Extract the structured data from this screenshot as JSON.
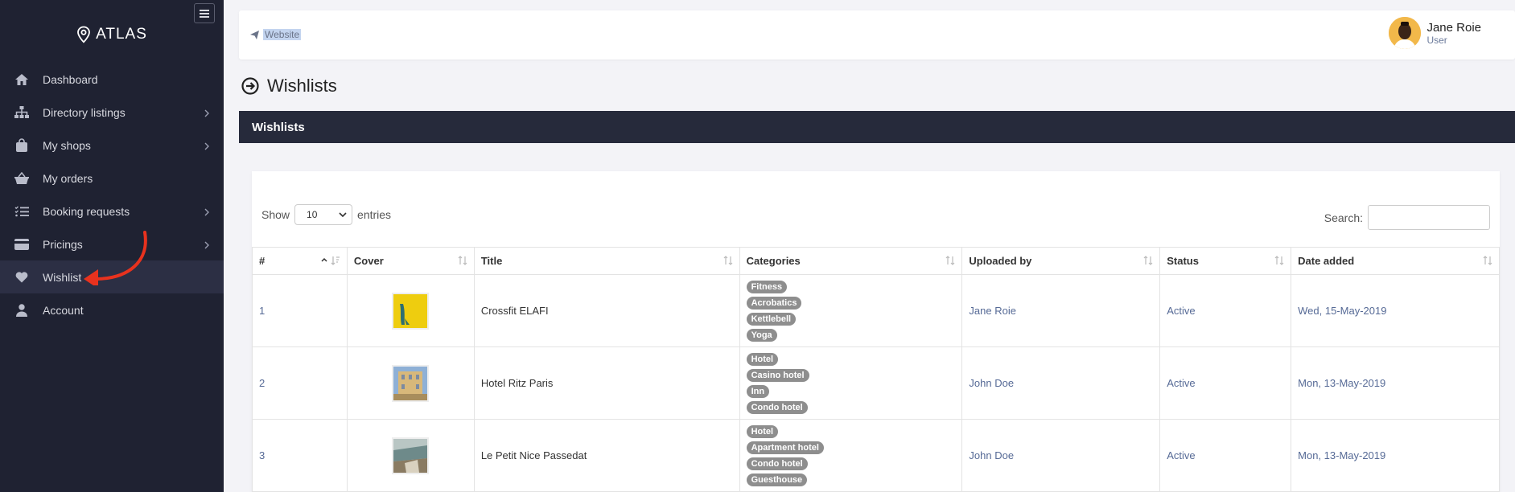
{
  "sidebar": {
    "brand": "ATLAS",
    "items": [
      {
        "label": "Dashboard",
        "icon": "home-icon",
        "chevron": false
      },
      {
        "label": "Directory listings",
        "icon": "sitemap-icon",
        "chevron": true
      },
      {
        "label": "My shops",
        "icon": "shopping-bag-icon",
        "chevron": true
      },
      {
        "label": "My orders",
        "icon": "basket-icon",
        "chevron": false
      },
      {
        "label": "Booking requests",
        "icon": "list-check-icon",
        "chevron": true
      },
      {
        "label": "Pricings",
        "icon": "credit-card-icon",
        "chevron": true
      },
      {
        "label": "Wishlist",
        "icon": "heart-icon",
        "chevron": false
      },
      {
        "label": "Account",
        "icon": "user-icon",
        "chevron": false
      }
    ]
  },
  "topbar": {
    "website_label": "Website",
    "user_name": "Jane Roie",
    "user_role": "User"
  },
  "page": {
    "title": "Wishlists"
  },
  "card": {
    "header": "Wishlists",
    "show_label": "Show",
    "entries_value": "10",
    "entries_label": "entries",
    "search_label": "Search:"
  },
  "table": {
    "columns": [
      "#",
      "Cover",
      "Title",
      "Categories",
      "Uploaded by",
      "Status",
      "Date added"
    ],
    "rows": [
      {
        "num": "1",
        "title": "Crossfit ELAFI",
        "categories": [
          "Fitness",
          "Acrobatics",
          "Kettlebell",
          "Yoga"
        ],
        "uploaded_by": "Jane Roie",
        "status": "Active",
        "date": "Wed, 15-May-2019"
      },
      {
        "num": "2",
        "title": "Hotel Ritz Paris",
        "categories": [
          "Hotel",
          "Casino hotel",
          "Inn",
          "Condo hotel"
        ],
        "uploaded_by": "John Doe",
        "status": "Active",
        "date": "Mon, 13-May-2019"
      },
      {
        "num": "3",
        "title": "Le Petit Nice Passedat",
        "categories": [
          "Hotel",
          "Apartment hotel",
          "Condo hotel",
          "Guesthouse"
        ],
        "uploaded_by": "John Doe",
        "status": "Active",
        "date": "Mon, 13-May-2019"
      }
    ]
  },
  "colors": {
    "sidebar_bg": "#1f2232",
    "card_header_bg": "#262a3b",
    "annotation_red": "#e8321e",
    "link_blue": "#566a96"
  }
}
